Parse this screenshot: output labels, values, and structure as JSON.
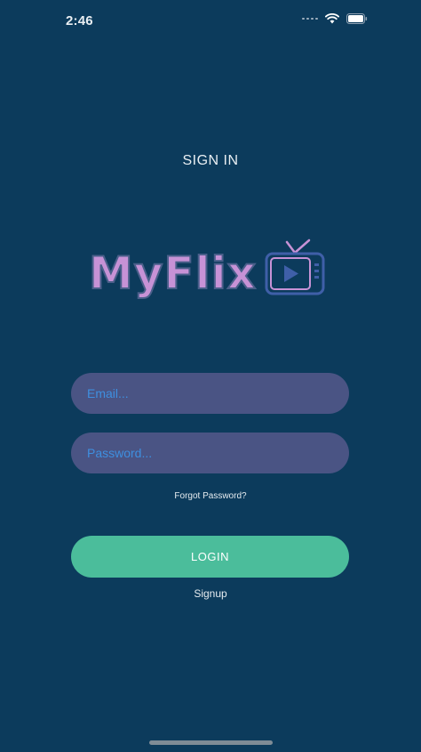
{
  "status_bar": {
    "time": "2:46",
    "wifi_icon": "wifi-icon",
    "battery_icon": "battery-icon"
  },
  "header": {
    "title": "SIGN IN"
  },
  "logo": {
    "text": "MyFlix",
    "icon": "tv-play-icon",
    "text_color": "#c792d6",
    "icon_color": "#3f5fa8"
  },
  "form": {
    "email_placeholder": "Email...",
    "email_value": "",
    "password_placeholder": "Password...",
    "password_value": "",
    "forgot_label": "Forgot Password?",
    "login_label": "LOGIN",
    "signup_label": "Signup"
  },
  "colors": {
    "background": "#0c3b5c",
    "input_background": "#4a5484",
    "placeholder": "#3e8fe0",
    "login_button": "#4bbd9b"
  }
}
